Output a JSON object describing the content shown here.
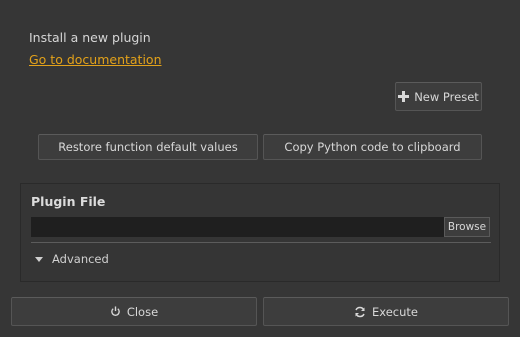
{
  "header": {
    "title": "Install a new plugin",
    "doc_link": "Go to documentation"
  },
  "toolbar": {
    "new_preset_label": "New Preset",
    "restore_label": "Restore function default values",
    "copy_label": "Copy Python code to clipboard"
  },
  "plugin_file": {
    "label": "Plugin File",
    "value": "",
    "browse_label": "Browse",
    "advanced_label": "Advanced"
  },
  "footer": {
    "close_label": "Close",
    "execute_label": "Execute"
  },
  "icons": {
    "new_preset": "plus-icon",
    "close": "power-icon",
    "execute": "refresh-icon",
    "advanced": "triangle-down-icon"
  },
  "colors": {
    "background": "#363636",
    "link": "#e3a21a",
    "input_bg": "#1f1f1f"
  }
}
